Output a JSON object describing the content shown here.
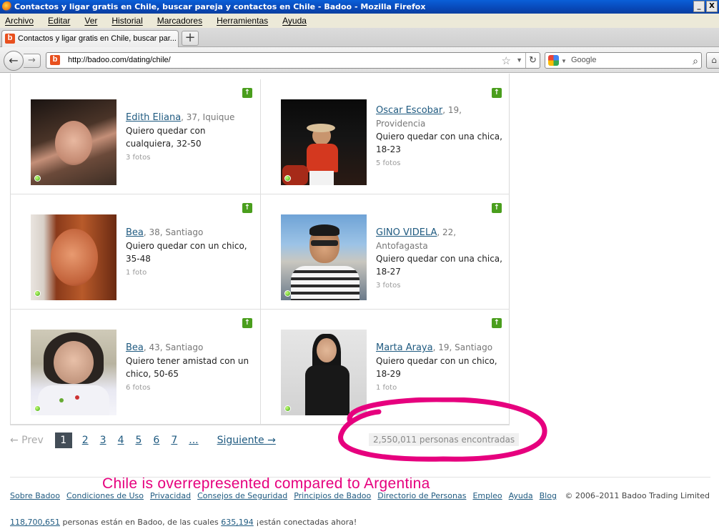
{
  "window": {
    "title": "Contactos y ligar gratis en Chile, buscar pareja y contactos en Chile - Badoo - Mozilla Firefox",
    "min": "_",
    "close": "X"
  },
  "menu": {
    "items": [
      "Archivo",
      "Editar",
      "Ver",
      "Historial",
      "Marcadores",
      "Herramientas",
      "Ayuda"
    ]
  },
  "tab": {
    "label": "Contactos y ligar gratis en Chile, buscar par...",
    "new_tab": "+"
  },
  "nav": {
    "back": "←",
    "forward": "→",
    "url": "http://badoo.com/dating/chile/",
    "star": "☆",
    "reload": "↻",
    "search_placeholder": "Google",
    "search_icon": "⌕",
    "home": "⌂"
  },
  "profiles": [
    {
      "name": "Edith Eliana",
      "meta": ", 37, Iquique",
      "desc": "Quiero quedar con cualquiera, 32-50",
      "photos": "3 fotos"
    },
    {
      "name": "Oscar Escobar",
      "meta": ", 19, Providencia",
      "desc": "Quiero quedar con una chica, 18-23",
      "photos": "5 fotos"
    },
    {
      "name": "Bea",
      "meta": ", 38, Santiago",
      "desc": "Quiero quedar con un chico, 35-48",
      "photos": "1 foto"
    },
    {
      "name": "GINO VIDELA",
      "meta": ", 22, Antofagasta",
      "desc": "Quiero quedar con una chica, 18-27",
      "photos": "3 fotos"
    },
    {
      "name": "Bea",
      "meta": ", 43, Santiago",
      "desc": "Quiero tener amistad con un chico, 50-65",
      "photos": "6 fotos"
    },
    {
      "name": "Marta Araya",
      "meta": ", 19, Santiago",
      "desc": "Quiero quedar con un chico, 18-29",
      "photos": "1 foto"
    }
  ],
  "pager": {
    "prev": "← Prev",
    "pages": [
      "1",
      "2",
      "3",
      "4",
      "5",
      "6",
      "7",
      "..."
    ],
    "next": "Siguiente →"
  },
  "found": "2,550,011 personas encontradas",
  "annotation": "Chile is overrepresented compared to Argentina",
  "footer": {
    "links": [
      "Sobre Badoo",
      "Condiciones de Uso",
      "Privacidad",
      "Consejos de Seguridad",
      "Principios de Badoo",
      "Directorio de Personas",
      "Empleo",
      "Ayuda",
      "Blog"
    ],
    "copyright": "© 2006–2011 Badoo Trading Limited",
    "stats_total": "118,700,651",
    "stats_mid": " personas están en Badoo, de las cuales ",
    "stats_online": "635,194",
    "stats_end": " ¡están conectadas ahora!"
  }
}
